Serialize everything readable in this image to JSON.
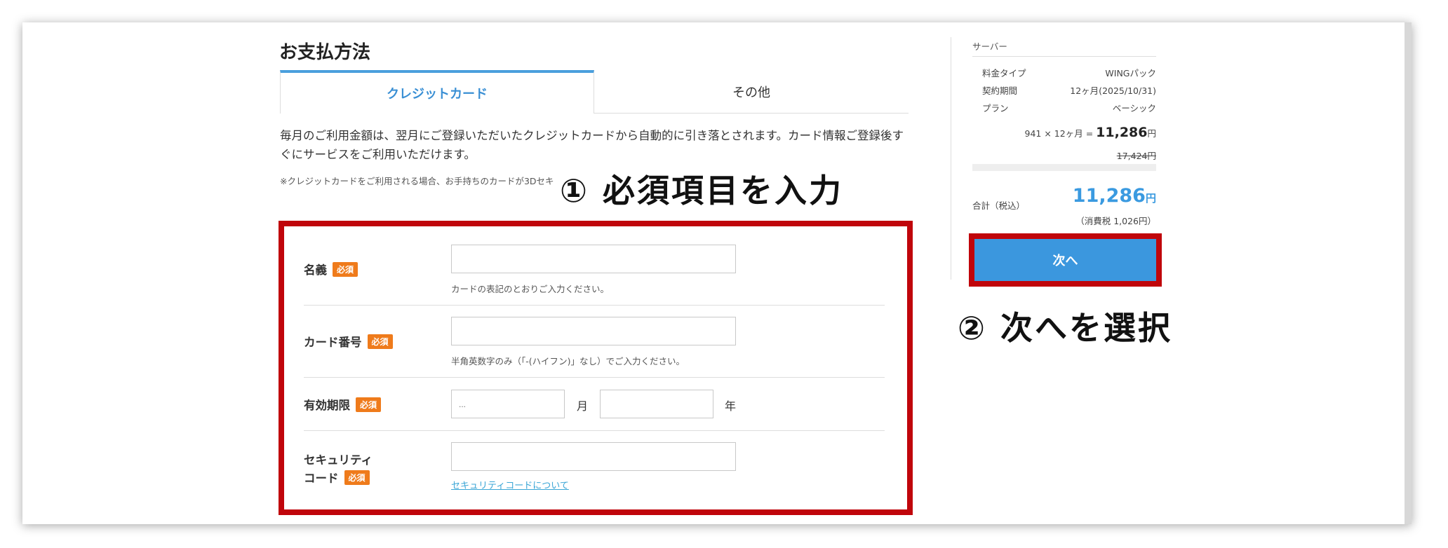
{
  "payment": {
    "title": "お支払方法",
    "tabs": {
      "credit": "クレジットカード",
      "other": "その他"
    },
    "description": "毎月のご利用金額は、翌月にご登録いただいたクレジットカードから自動的に引き落とされます。カード情報ご登録後すぐにサービスをご利用いただけます。",
    "note": "※クレジットカードをご利用される場合、お手持ちのカードが3Dセキ"
  },
  "annotations": {
    "step1": "① 必須項目を入力",
    "step2": "② 次へを選択"
  },
  "form": {
    "required_badge": "必須",
    "name": {
      "label": "名義",
      "hint": "カードの表記のとおりご入力ください。"
    },
    "card_number": {
      "label": "カード番号",
      "hint": "半角英数字のみ（「-(ハイフン)」なし）でご入力ください。"
    },
    "expiry": {
      "label": "有効期限",
      "month_unit": "月",
      "year_unit": "年",
      "month_placeholder": "..."
    },
    "security": {
      "label_line1": "セキュリティ",
      "label_line2": "コード",
      "link": "セキュリティコードについて"
    }
  },
  "sidebar": {
    "title": "サーバー",
    "rows": [
      {
        "key": "料金タイプ",
        "value": "WINGパック"
      },
      {
        "key": "契約期間",
        "value": "12ヶ月(2025/10/31)"
      },
      {
        "key": "プラン",
        "value": "ベーシック"
      }
    ],
    "calc_prefix": "941 × 12ヶ月 =",
    "calc_amount": "11,286",
    "yen": "円",
    "original_price": "17,424円",
    "total_label": "合計（税込）",
    "total_amount": "11,286",
    "tax_note": "（消費税 1,026円）",
    "next_button": "次へ"
  },
  "colors": {
    "accent": "#3b97de",
    "required": "#ef7b1b",
    "highlight": "#c0050b"
  }
}
